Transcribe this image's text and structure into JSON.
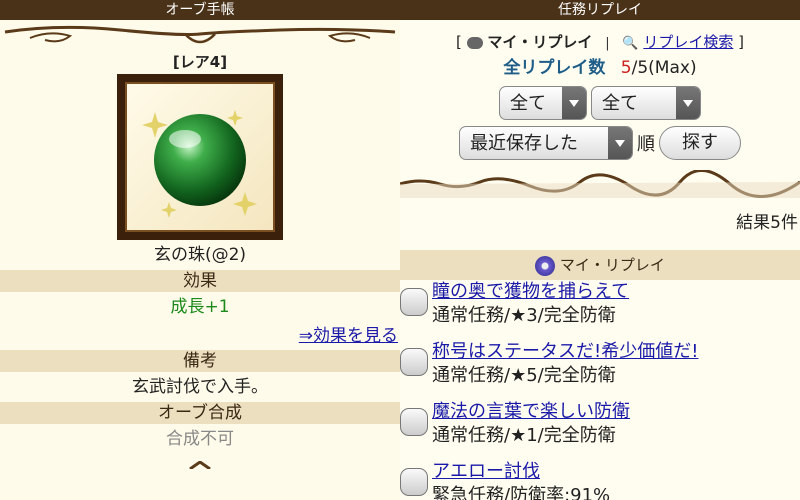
{
  "left": {
    "title": "オーブ手帳",
    "rarity": "[レア4]",
    "item_name": "玄の珠(@2)",
    "effect_head": "効果",
    "effect_value": "成長+1",
    "effect_link": "⇒効果を見る",
    "note_head": "備考",
    "note_value": "玄武討伐で入手。",
    "synth_head": "オーブ合成",
    "synth_value": "合成不可"
  },
  "right": {
    "title": "任務リプレイ",
    "bracket_open": "[",
    "my_replay": "マイ・リプレイ",
    "divider": "|",
    "search_replay": "リプレイ検索",
    "bracket_close": "]",
    "count_label": "全リプレイ数",
    "count_current": "5",
    "count_rest": "/5(Max)",
    "filter1": "全て",
    "filter2": "全て",
    "sort_select": "最近保存した",
    "sort_suffix": "順",
    "search_button": "探す",
    "results": "結果5件",
    "list_header": "マイ・リプレイ",
    "missions": [
      {
        "title": "瞳の奥で獲物を捕らえて",
        "sub": "通常任務/★3/完全防衛"
      },
      {
        "title": "称号はステータスだ!希少価値だ!",
        "sub": "通常任務/★5/完全防衛"
      },
      {
        "title": "魔法の言葉で楽しい防衛",
        "sub": "通常任務/★1/完全防衛"
      },
      {
        "title": "アエロー討伐",
        "sub": "緊急任務/防衛率:91%"
      }
    ]
  },
  "colors": {
    "header_bg": "#4a3218",
    "link": "#1a1aa8",
    "effect": "#1b8a1b",
    "count_num": "#cc2020"
  }
}
